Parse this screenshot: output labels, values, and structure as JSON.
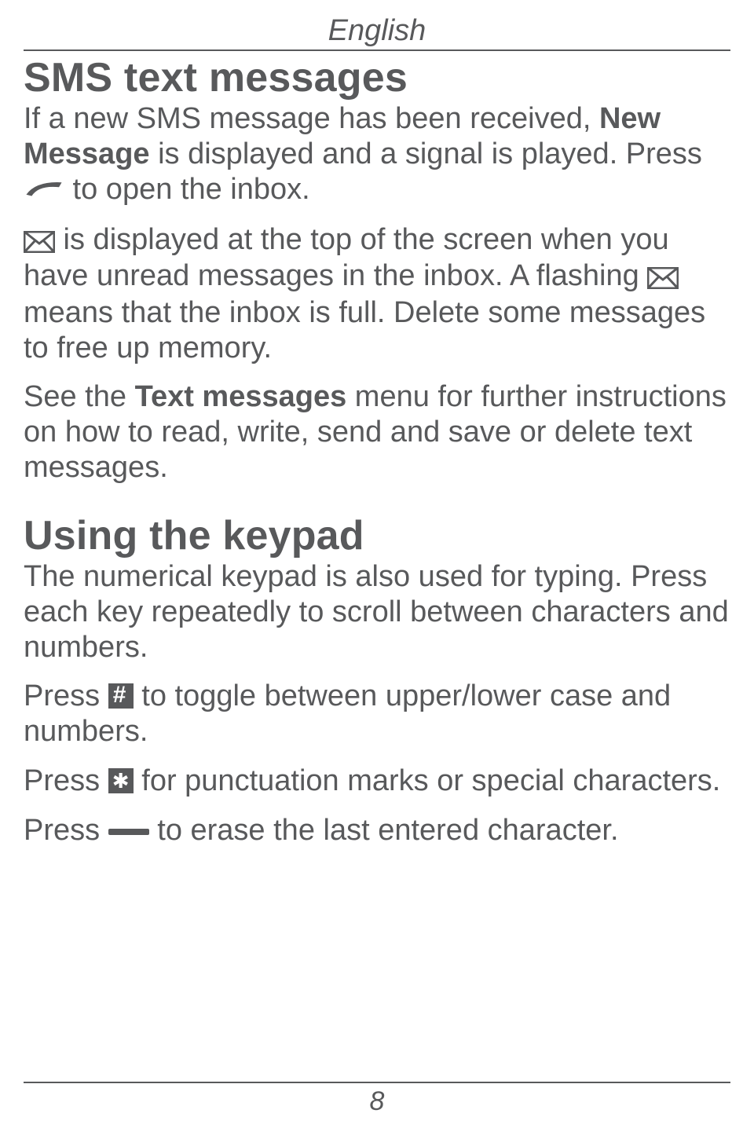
{
  "header": {
    "language": "English"
  },
  "section1": {
    "title": "SMS text messages",
    "p1a": "If a new SMS message has been received, ",
    "p1b": "New Message",
    "p1c": " is displayed and a signal is played. Press ",
    "p1d": " to open the inbox.",
    "p2a": " is displayed at the top of the screen when you have unread messages in the inbox. A flashing ",
    "p2b": " means that the inbox is full. Delete some messages to free up memory.",
    "p3a": "See the ",
    "p3b": "Text messages",
    "p3c": " menu for further instructions on how to read, write, send and save or delete text messages."
  },
  "section2": {
    "title": "Using the keypad",
    "p1": "The numerical keypad is also used for typing. Press each key repeatedly to scroll between characters and numbers.",
    "p2a": "Press ",
    "p2b": " to toggle between upper/lower case and numbers.",
    "p3a": "Press ",
    "p3b": " for punctuation marks or special characters.",
    "p4a": "Press ",
    "p4b": " to erase the last entered character."
  },
  "footer": {
    "page": "8"
  }
}
